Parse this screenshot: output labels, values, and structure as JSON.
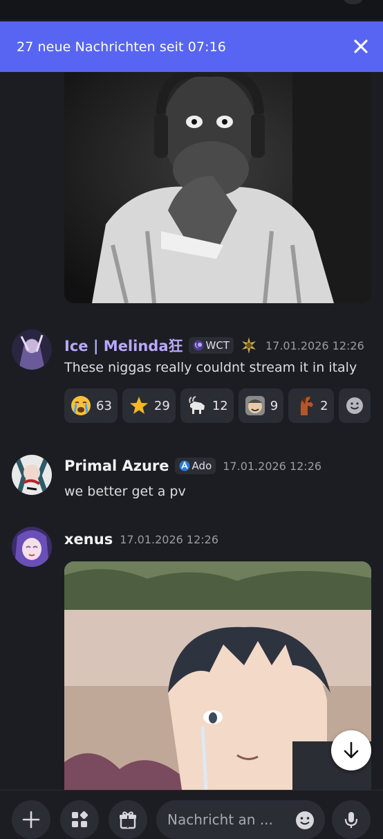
{
  "banner": {
    "text": "27 neue Nachrichten seit 07:16"
  },
  "messages": [
    {
      "username": "Ice | Melinda狂",
      "tag": "WCT",
      "timestamp": "17.01.2026 12:26",
      "content": "These niggas really couldnt stream it in italy",
      "reactions": [
        {
          "emoji": "crying-face-icon",
          "count": "63"
        },
        {
          "emoji": "star-icon",
          "count": "29"
        },
        {
          "emoji": "goat-icon",
          "count": "12"
        },
        {
          "emoji": "grinning-man-icon",
          "count": "9"
        },
        {
          "emoji": "horse-icon",
          "count": "2"
        }
      ]
    },
    {
      "username": "Primal Azure",
      "tag": "Ado",
      "timestamp": "17.01.2026 12:26",
      "content": "we better get a pv"
    },
    {
      "username": "xenus",
      "timestamp": "17.01.2026 12:26"
    }
  ],
  "composer": {
    "placeholder": "Nachricht an ..."
  },
  "colors": {
    "accent": "#5865f2",
    "background": "#1c1d22",
    "surface": "#2b2d35",
    "username_purple": "#b9a8ff"
  }
}
